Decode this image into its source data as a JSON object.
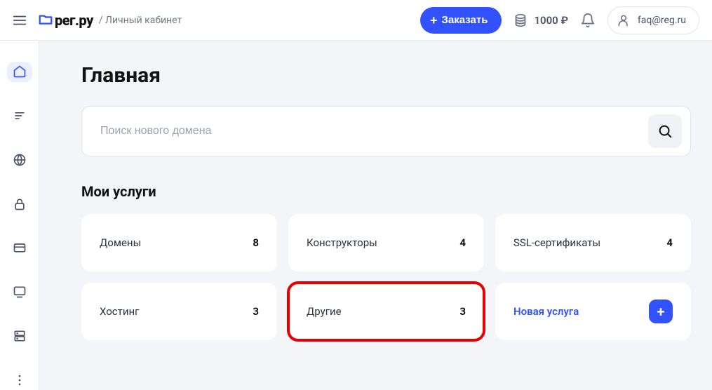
{
  "header": {
    "logo_text": "рег.ру",
    "breadcrumb": "/ Личный кабинет",
    "order_label": "Заказать",
    "balance": "1000 ₽",
    "user_email": "faq@reg.ru"
  },
  "main": {
    "page_title": "Главная",
    "search_placeholder": "Поиск нового домена",
    "section_title": "Мои услуги"
  },
  "cards": [
    {
      "label": "Домены",
      "count": "8"
    },
    {
      "label": "Конструкторы",
      "count": "4"
    },
    {
      "label": "SSL-сертификаты",
      "count": "4"
    },
    {
      "label": "Хостинг",
      "count": "3"
    },
    {
      "label": "Другие",
      "count": "3"
    }
  ],
  "new_service_label": "Новая услуга"
}
